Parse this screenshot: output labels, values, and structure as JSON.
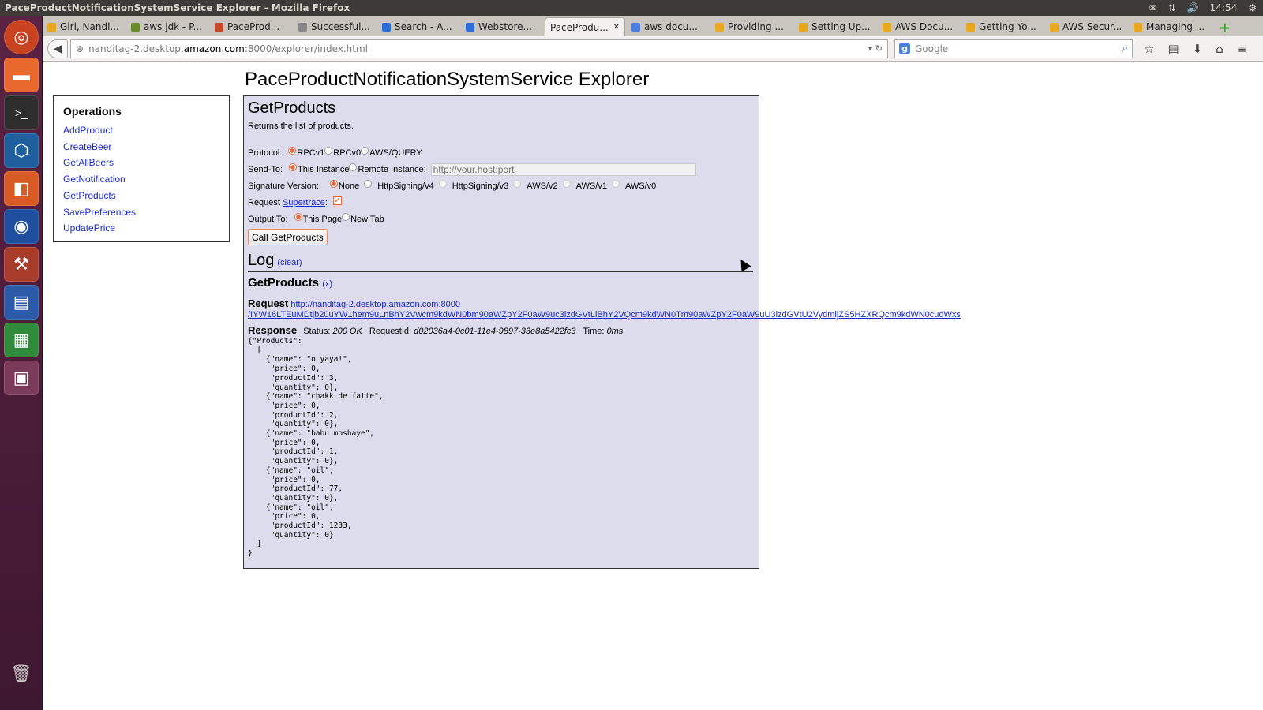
{
  "window": {
    "title": "PaceProductNotificationSystemService Explorer - Mozilla Firefox",
    "clock": "14:54"
  },
  "tabs": [
    {
      "label": "Giri, Nandi...",
      "color": "#e8a81f"
    },
    {
      "label": "aws jdk - P...",
      "color": "#6a8a2a"
    },
    {
      "label": "PaceProd...",
      "color": "#c54a2a"
    },
    {
      "label": "Successful...",
      "color": "#888888"
    },
    {
      "label": "Search - A...",
      "color": "#2b6fd6"
    },
    {
      "label": "Webstore...",
      "color": "#2b6fd6"
    },
    {
      "label": "PaceProdu...",
      "color": "#ffffff",
      "active": true
    },
    {
      "label": "aws docu...",
      "color": "#4a7fde"
    },
    {
      "label": "Providing ...",
      "color": "#e8a81f"
    },
    {
      "label": "Setting Up...",
      "color": "#e8a81f"
    },
    {
      "label": "AWS Docu...",
      "color": "#e8a81f"
    },
    {
      "label": "Getting Yo...",
      "color": "#e8a81f"
    },
    {
      "label": "AWS Secur...",
      "color": "#e8a81f"
    },
    {
      "label": "Managing ...",
      "color": "#e8a81f"
    }
  ],
  "url": {
    "prefix": "nanditag-2.desktop.",
    "host": "amazon.com",
    "suffix": ":8000/explorer/index.html"
  },
  "search": {
    "placeholder": "Google"
  },
  "page": {
    "title": "PaceProductNotificationSystemService Explorer"
  },
  "operations": {
    "heading": "Operations",
    "items": [
      "AddProduct",
      "CreateBeer",
      "GetAllBeers",
      "GetNotification",
      "GetProducts",
      "SavePreferences",
      "UpdatePrice"
    ]
  },
  "panel": {
    "title": "GetProducts",
    "description": "Returns the list of products.",
    "protocol": {
      "label": "Protocol:",
      "options": [
        "RPCv1",
        "RPCv0",
        "AWS/QUERY"
      ],
      "selected": "RPCv1"
    },
    "sendto": {
      "label": "Send-To:",
      "option1": "This Instance",
      "option2": "Remote Instance:",
      "placeholder": "http://your.host:port"
    },
    "signature": {
      "label": "Signature Version:",
      "options": [
        "None",
        "HttpSigning/v4",
        "HttpSigning/v3",
        "AWS/v2",
        "AWS/v1",
        "AWS/v0"
      ],
      "selected": "None"
    },
    "trace": {
      "label_prefix": "Request ",
      "link": "Supertrace",
      "label_suffix": ":",
      "checked": true
    },
    "output": {
      "label": "Output To:",
      "option1": "This Page",
      "option2": "New Tab"
    },
    "call_button": "Call GetProducts"
  },
  "log": {
    "title": "Log",
    "clear": "(clear)",
    "operation": "GetProducts",
    "close": "(x)",
    "request_label": "Request",
    "request_url_line1": "http://nanditag-2.desktop.amazon.com:8000",
    "request_url_line2": "/!YW16LTEuMDtjb20uYW1hem9uLnBhY2Vwcm9kdWN0bm90aWZpY2F0aW9uc3lzdGVtLlBhY2VQcm9kdWN0Tm90aWZpY2F0aW9uU3lzdGVtU2VydmljZS5HZXRQcm9kdWN0cudWxs",
    "response_label": "Response",
    "status_label": "Status:",
    "status": "200 OK",
    "requestid_label": "RequestId:",
    "requestid": "d02036a4-0c01-11e4-9897-33e8a5422fc3",
    "time_label": "Time:",
    "time": "0ms",
    "body": "{\"Products\":\n  [\n    {\"name\": \"o yaya!\",\n     \"price\": 0,\n     \"productId\": 3,\n     \"quantity\": 0},\n    {\"name\": \"chakk de fatte\",\n     \"price\": 0,\n     \"productId\": 2,\n     \"quantity\": 0},\n    {\"name\": \"babu moshaye\",\n     \"price\": 0,\n     \"productId\": 1,\n     \"quantity\": 0},\n    {\"name\": \"oil\",\n     \"price\": 0,\n     \"productId\": 77,\n     \"quantity\": 0},\n    {\"name\": \"oil\",\n     \"price\": 0,\n     \"productId\": 1233,\n     \"quantity\": 0}\n  ]\n}"
  },
  "launcher_icons": [
    "ubuntu-icon",
    "files-icon",
    "terminal-icon",
    "virtualbox-icon",
    "software-center-icon",
    "firefox-icon",
    "settings-icon",
    "writer-icon",
    "calc-icon",
    "workspace-icon",
    "trash-icon"
  ]
}
